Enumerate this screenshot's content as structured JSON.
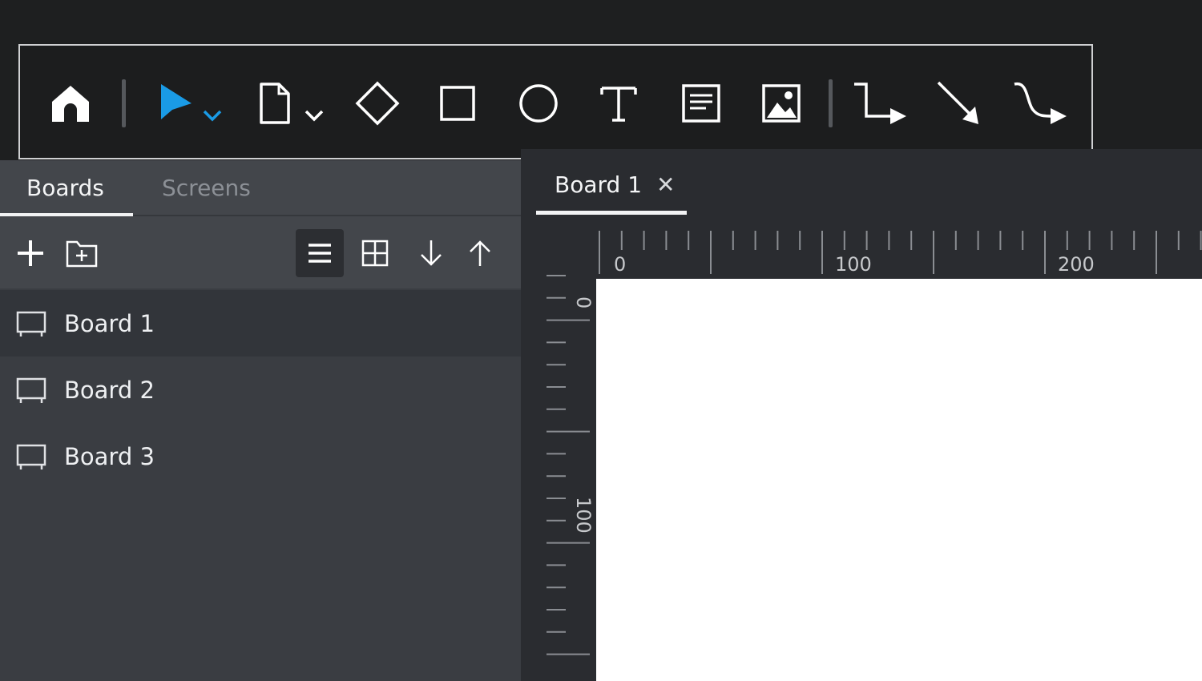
{
  "toolbar": {
    "tools": [
      {
        "name": "home-icon"
      },
      {
        "name": "select-pointer-icon"
      },
      {
        "name": "page-icon"
      },
      {
        "name": "diamond-icon"
      },
      {
        "name": "rectangle-icon"
      },
      {
        "name": "circle-icon"
      },
      {
        "name": "text-icon"
      },
      {
        "name": "text-block-icon"
      },
      {
        "name": "image-icon"
      },
      {
        "name": "elbow-connector-icon"
      },
      {
        "name": "straight-arrow-icon"
      },
      {
        "name": "curved-connector-icon"
      }
    ],
    "accent_color": "#1a9be6"
  },
  "left_panel": {
    "tabs": [
      {
        "label": "Boards",
        "active": true
      },
      {
        "label": "Screens",
        "active": false
      }
    ],
    "actions": [
      "plus-icon",
      "new-folder-icon",
      "list-view-icon",
      "grid-view-icon",
      "arrow-down-icon",
      "arrow-up-icon"
    ],
    "boards": [
      {
        "label": "Board 1",
        "selected": true
      },
      {
        "label": "Board 2",
        "selected": false
      },
      {
        "label": "Board 3",
        "selected": false
      }
    ]
  },
  "document": {
    "tab_label": "Board 1",
    "close_glyph": "✕",
    "ruler": {
      "h_labels": [
        "0",
        "100",
        "200"
      ],
      "v_labels": [
        "0",
        "100"
      ]
    }
  }
}
